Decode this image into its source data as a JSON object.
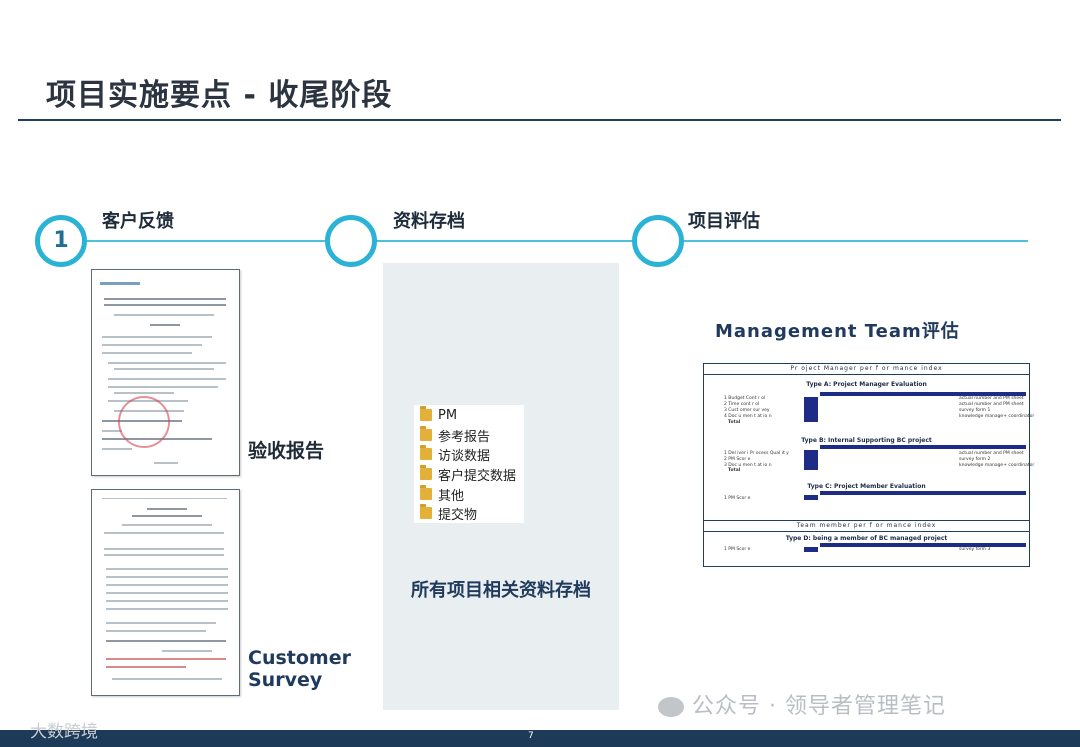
{
  "title": "项目实施要点 - 收尾阶段",
  "steps": [
    {
      "number": "1",
      "label": "客户反馈"
    },
    {
      "number": "",
      "label": "资料存档"
    },
    {
      "number": "",
      "label": "项目评估"
    }
  ],
  "feedback": {
    "acceptance_caption": "验收报告",
    "survey_caption_line1": "Customer",
    "survey_caption_line2": "Survey"
  },
  "archive": {
    "folders": [
      {
        "name": "PM",
        "icon": "folder-icon"
      },
      {
        "name": "参考报告",
        "icon": "folder-icon"
      },
      {
        "name": "访谈数据",
        "icon": "folder-icon"
      },
      {
        "name": "客户提交数据",
        "icon": "folder-icon"
      },
      {
        "name": "其他",
        "icon": "folder-icon"
      },
      {
        "name": "提交物",
        "icon": "folder-icon"
      }
    ],
    "caption": "所有项目相关资料存档"
  },
  "evaluation": {
    "title": "Management Team评估",
    "sheet": {
      "header1": "Pr oject  Manager  per f or mance index",
      "typeA": "Type A: Project Manager Evaluation",
      "typeA_rows": [
        "1  Budget  Cont r ol",
        "2  Time cont r ol",
        "3  Cust omer  sur vey",
        "4  Doc u men t at io n",
        "Total"
      ],
      "typeA_measured": [
        "actual number and  PM sheet",
        "actual number and  PM sheet",
        "survey form 1",
        "knowledge manage+ coordinator"
      ],
      "typeB": "Type B: Internal Supporting BC project",
      "typeB_rows": [
        "1  Del iver i Pr ocess Qual it y",
        "2  PM Scor e",
        "3  Doc u men t at io n",
        "Total"
      ],
      "typeB_measured": [
        "actual number and  PM sheet",
        "survey form 2",
        "knowledge manage+ coordinator"
      ],
      "typeC": "Type C: Project Member Evaluation",
      "typeC_row": "1  PM Scor e",
      "header2": "Team member  per f or mance index",
      "typeD": "Type D: being a member of BC managed project",
      "typeD_row": "1  PM Scor e",
      "typeD_measured": "survey form 3"
    }
  },
  "footer": {
    "page_number": "7",
    "watermark_right": "公众号 · 领导者管理笔记",
    "watermark_left": "大数跨境"
  }
}
